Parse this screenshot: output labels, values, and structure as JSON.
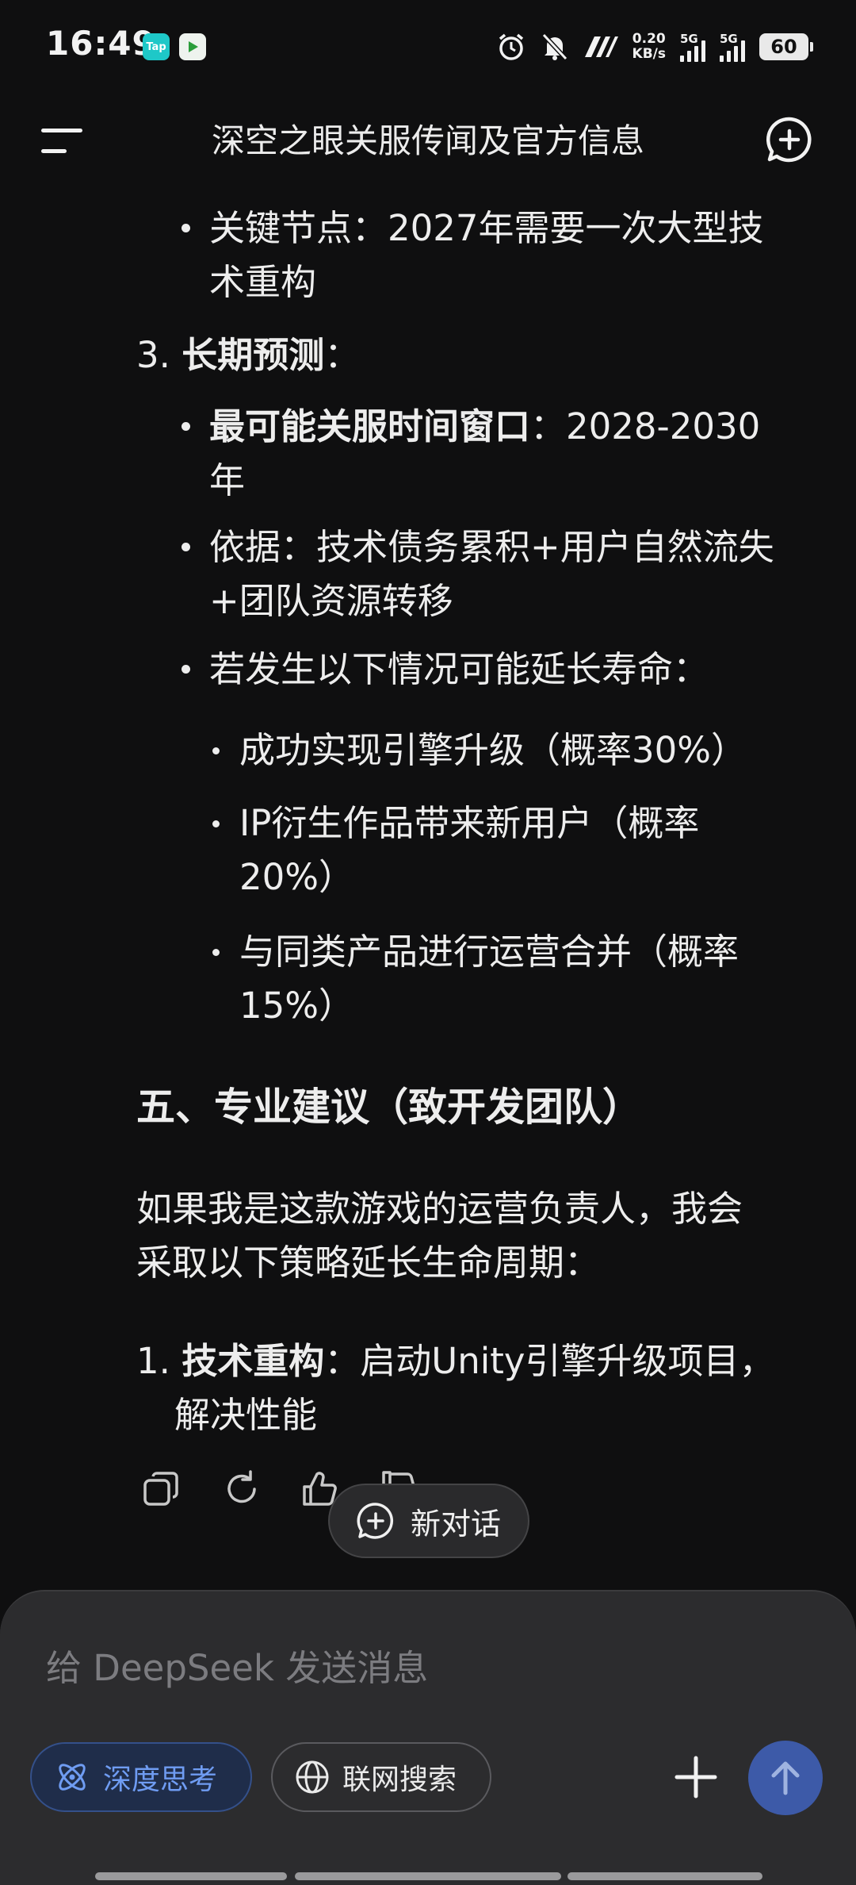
{
  "status_bar": {
    "time": "16:49",
    "app_icons": [
      "Tap",
      "一起来"
    ],
    "net_speed_value": "0.20",
    "net_speed_unit": "KB/s",
    "signal_1": "5G",
    "signal_2": "5G",
    "battery": "60"
  },
  "header": {
    "title": "深空之眼关服传闻及官方信息"
  },
  "content": {
    "item_key_node": "关键节点：2027年需要一次大型技",
    "item_key_node_cont": "术重构",
    "section3_number": "3.",
    "section3_title": "长期预测",
    "section3_colon": "：",
    "item_window_label": "最可能关服时间窗口",
    "item_window_value": "：2028-2030",
    "item_window_cont": "年",
    "item_basis": "依据：技术债务累积+用户自然流失",
    "item_basis_cont": "+团队资源转移",
    "item_extend": "若发生以下情况可能延长寿命：",
    "sub_engine": "成功实现引擎升级（概率30%）",
    "sub_ip": "IP衍生作品带来新用户（概率",
    "sub_ip_cont": "20%）",
    "sub_merge": "与同类产品进行运营合并（概率",
    "sub_merge_cont": "15%）",
    "section5_heading": "五、专业建议（致开发团队）",
    "para_line1": "如果我是这款游戏的运营负责人，我会",
    "para_line2": "采取以下策略延长生命周期：",
    "list1_number": "1.",
    "list1_title": "技术重构",
    "list1_text": "：启动Unity引擎升级项目，",
    "list1_cont": "解决性能"
  },
  "floating": {
    "new_chat_label": "新对话"
  },
  "composer": {
    "placeholder": "给 DeepSeek 发送消息",
    "deep_think_label": "深度思考",
    "web_search_label": "联网搜索"
  },
  "colors": {
    "background": "#0f0f10",
    "composer_bg": "#2c2c2e",
    "accent_blue": "#6f9cf2",
    "send_button": "#3d5aa8"
  }
}
